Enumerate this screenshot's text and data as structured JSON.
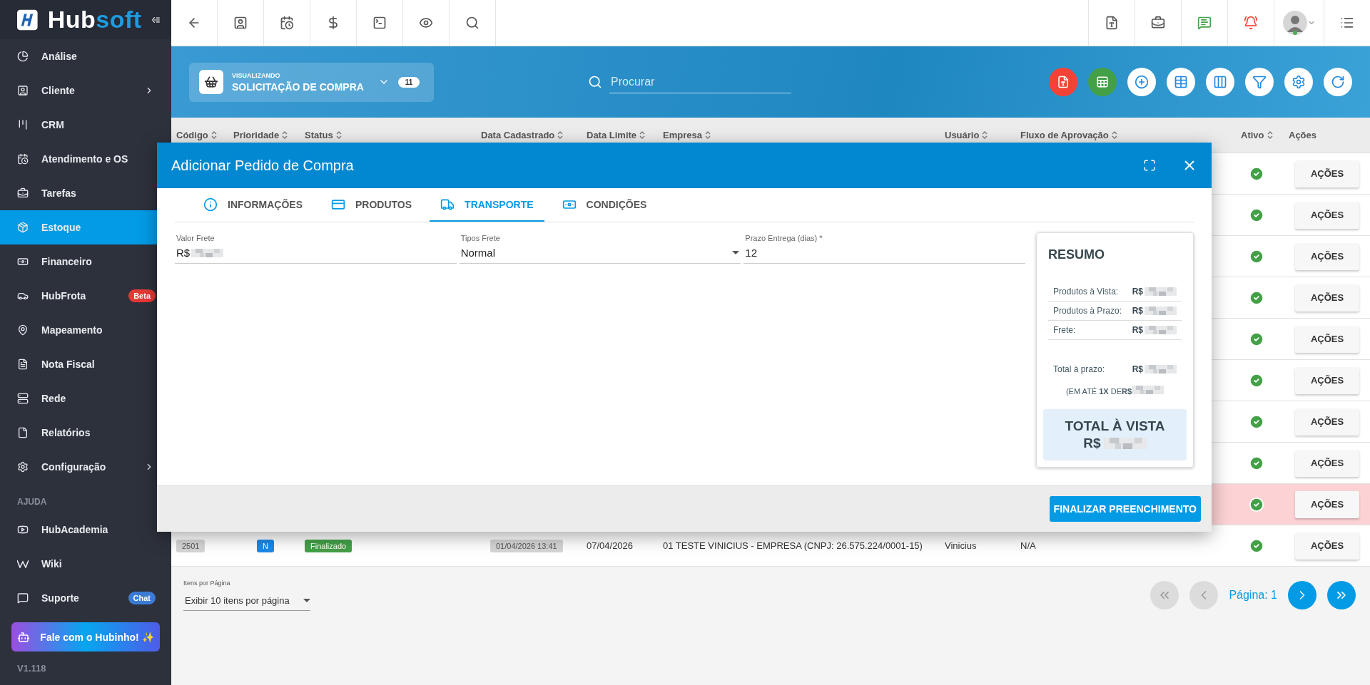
{
  "sidebar": {
    "logo_main": "Hub",
    "logo_accent": "soft",
    "items": [
      {
        "label": "Análise",
        "selected": false,
        "submenu": false
      },
      {
        "label": "Cliente",
        "selected": false,
        "submenu": true
      },
      {
        "label": "CRM",
        "selected": false,
        "submenu": false
      },
      {
        "label": "Atendimento e OS",
        "selected": false,
        "submenu": false
      },
      {
        "label": "Tarefas",
        "selected": false,
        "submenu": false
      },
      {
        "label": "Estoque",
        "selected": true,
        "submenu": false
      },
      {
        "label": "Financeiro",
        "selected": false,
        "submenu": false
      },
      {
        "label": "HubFrota",
        "selected": false,
        "submenu": false,
        "badge": {
          "text": "Beta",
          "color": "#e53935"
        }
      },
      {
        "label": "Mapeamento",
        "selected": false,
        "submenu": false
      },
      {
        "label": "Nota Fiscal",
        "selected": false,
        "submenu": false
      },
      {
        "label": "Rede",
        "selected": false,
        "submenu": false
      },
      {
        "label": "Relatórios",
        "selected": false,
        "submenu": false
      },
      {
        "label": "Configuração",
        "selected": false,
        "submenu": true
      }
    ],
    "section": "AJUDA",
    "help_items": [
      {
        "label": "HubAcademia",
        "selected": false
      },
      {
        "label": "Wiki",
        "selected": false
      },
      {
        "label": "Suporte",
        "selected": false,
        "badge": {
          "text": "Chat",
          "color": "#3a7bd5"
        }
      }
    ],
    "assistant_button": "Fale com o Hubinho! ✨",
    "version": "V1.118"
  },
  "header": {
    "viewing_label": "VISUALIZANDO",
    "view_title": "SOLICITAÇÃO DE COMPRA",
    "count": "11",
    "search_placeholder": "Procurar"
  },
  "table": {
    "columns": [
      {
        "label": "Código",
        "sortable": true
      },
      {
        "label": "Prioridade",
        "sortable": true
      },
      {
        "label": "Status",
        "sortable": true
      },
      {
        "label": "Data Cadastrado",
        "sortable": true
      },
      {
        "label": "Data Limite",
        "sortable": true
      },
      {
        "label": "Empresa",
        "sortable": true
      },
      {
        "label": "Usuário",
        "sortable": true
      },
      {
        "label": "Fluxo de Aprovação",
        "sortable": true
      },
      {
        "label": "Ativo",
        "sortable": true
      },
      {
        "label": "Ações",
        "sortable": false
      }
    ],
    "rows": [
      {
        "active": true,
        "highlighted": false,
        "action": "AÇÕES"
      },
      {
        "active": true,
        "highlighted": false,
        "action": "AÇÕES"
      },
      {
        "active": true,
        "highlighted": false,
        "action": "AÇÕES"
      },
      {
        "active": true,
        "highlighted": false,
        "action": "AÇÕES"
      },
      {
        "active": true,
        "highlighted": false,
        "action": "AÇÕES"
      },
      {
        "active": true,
        "highlighted": false,
        "action": "AÇÕES"
      },
      {
        "active": true,
        "highlighted": false,
        "action": "AÇÕES"
      },
      {
        "active": true,
        "highlighted": false,
        "action": "AÇÕES"
      },
      {
        "active": true,
        "highlighted": true,
        "action": "AÇÕES"
      },
      {
        "active": true,
        "highlighted": false,
        "action": "AÇÕES",
        "code": "2501",
        "priority": "N",
        "status": "Finalizado",
        "created": "01/04/2026 13:41",
        "deadline": "07/04/2026",
        "company": "01 TESTE VINICIUS - EMPRESA (CNPJ: 26.575.224/0001-15)",
        "user": "Vinicius",
        "flow": "N/A"
      }
    ]
  },
  "footer": {
    "per_page_label": "Itens por Página",
    "per_page_value": "Exibir 10 itens por página",
    "page_label": "Página: 1",
    "nav": [
      {
        "kind": "first",
        "disabled": true
      },
      {
        "kind": "previous",
        "disabled": true
      },
      {
        "kind": "next",
        "disabled": false
      },
      {
        "kind": "last",
        "disabled": false
      }
    ]
  },
  "modal": {
    "title": "Adicionar Pedido de Compra",
    "tabs": [
      {
        "label": "INFORMAÇÕES",
        "selected": false
      },
      {
        "label": "PRODUTOS",
        "selected": false
      },
      {
        "label": "TRANSPORTE",
        "selected": true
      },
      {
        "label": "CONDIÇÕES",
        "selected": false
      }
    ],
    "fields": [
      {
        "label": "Valor Frete",
        "kind": "currency",
        "value": "R$"
      },
      {
        "label": "Tipos Frete",
        "kind": "select",
        "value": "Normal"
      },
      {
        "label": "Prazo Entrega (dias) *",
        "kind": "text",
        "value": "12"
      }
    ],
    "summary": {
      "title": "RESUMO",
      "lines": [
        {
          "label": "Produtos à Vista:",
          "currency": "R$"
        },
        {
          "label": "Produtos à Prazo:",
          "currency": "R$"
        },
        {
          "label": "Frete:",
          "currency": "R$"
        }
      ],
      "total_label": "Total à prazo:",
      "total_currency": "R$",
      "installments": "(EM ATÉ **1X** DE**R$**",
      "cash_title": "TOTAL À VISTA",
      "cash_currency": "R$"
    },
    "finish_button": "FINALIZAR PREENCHIMENTO"
  }
}
